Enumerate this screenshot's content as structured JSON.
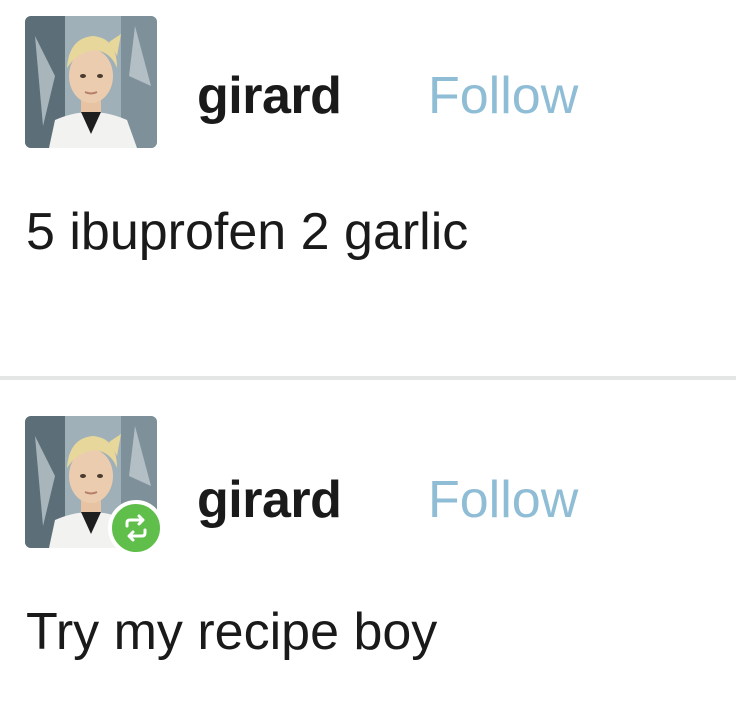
{
  "posts": [
    {
      "username": "girard",
      "follow_label": "Follow",
      "body": "5 ibuprofen 2 garlic",
      "avatar_icon": "user-avatar"
    },
    {
      "username": "girard",
      "follow_label": "Follow",
      "body": "Try my recipe boy",
      "avatar_icon": "user-avatar",
      "badge_icon": "reblog-icon"
    }
  ],
  "colors": {
    "follow_link": "#8fbdd6",
    "reblog_badge": "#5fbf4a",
    "divider": "#e4e6e6",
    "text": "#1a1a1a"
  }
}
